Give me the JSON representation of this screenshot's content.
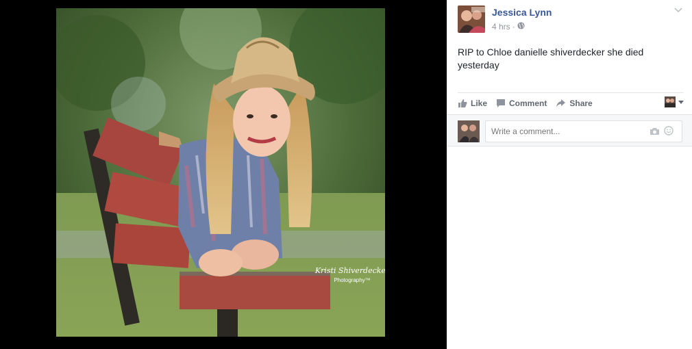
{
  "post": {
    "author": "Jessica Lynn",
    "time": "4 hrs",
    "separator": "·",
    "text": "RIP to Chloe danielle shiverdecker she died yesterday"
  },
  "photo": {
    "watermark_line1": "Kristi Shiverdecker",
    "watermark_line2": "Photography™"
  },
  "actions": {
    "like": "Like",
    "comment": "Comment",
    "share": "Share"
  },
  "comment_box": {
    "placeholder": "Write a comment..."
  },
  "icons": {
    "privacy": "globe-icon",
    "menu": "chevron-down-icon",
    "like": "thumbs-up-icon",
    "comment": "speech-bubble-icon",
    "share": "share-arrow-icon",
    "camera": "camera-icon",
    "emoji": "smiley-icon"
  },
  "colors": {
    "author_link": "#365899",
    "meta_text": "#90949c",
    "action_text": "#616770"
  }
}
